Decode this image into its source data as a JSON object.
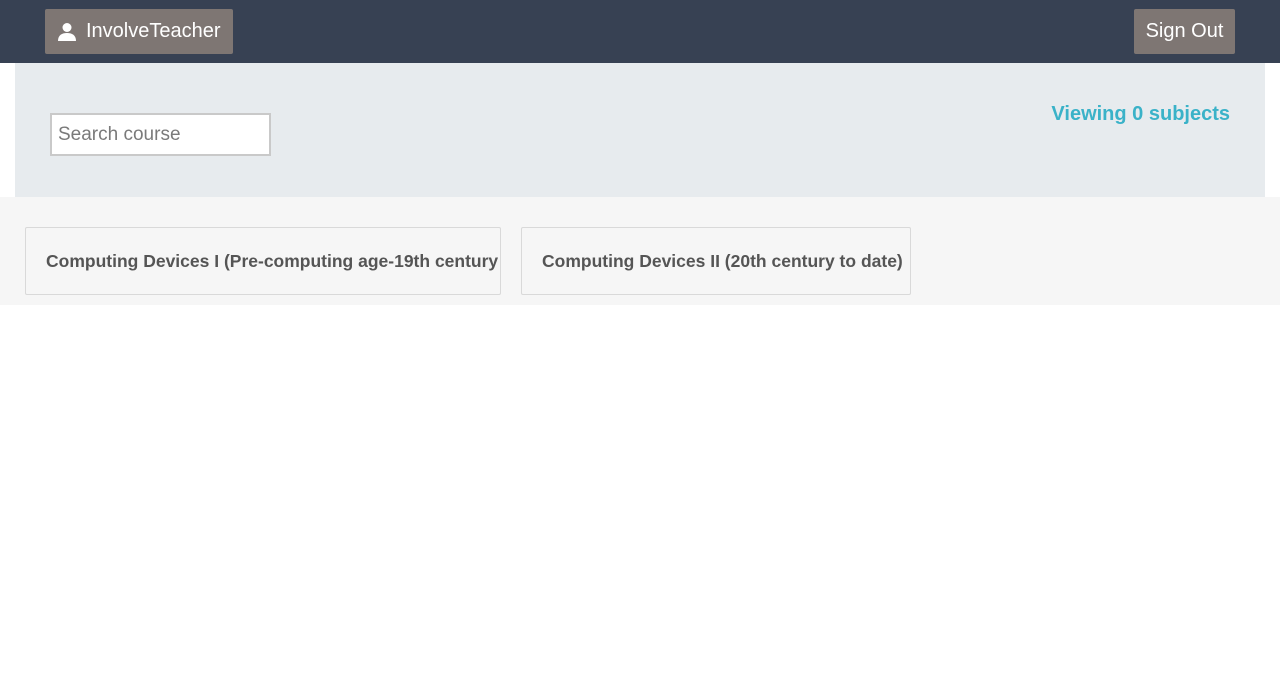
{
  "header": {
    "user_label": "InvolveTeacher",
    "user_icon": "user-icon",
    "signout_label": "Sign Out",
    "bg_color": "#374153",
    "button_color": "#7e7673"
  },
  "filter": {
    "search_placeholder": "Search course",
    "viewing_text": "Viewing 0 subjects",
    "accent_color": "#3ab2c8"
  },
  "courses": [
    {
      "title": "Computing Devices I (Pre-computing age-19th century"
    },
    {
      "title": "Computing Devices II (20th century to date)"
    }
  ]
}
